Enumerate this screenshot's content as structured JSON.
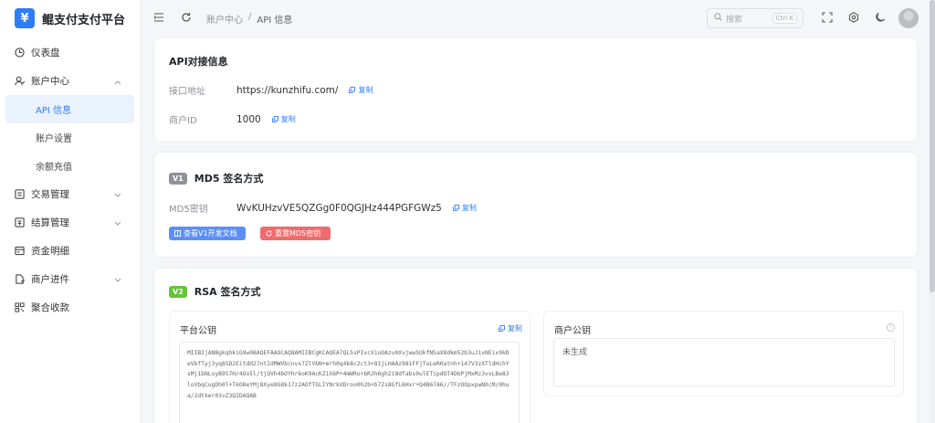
{
  "brand": {
    "title": "鲲支付支付平台",
    "logo_glyph": "¥"
  },
  "sidebar": {
    "items": [
      {
        "label": "仪表盘",
        "icon": "dashboard-icon"
      },
      {
        "label": "账户中心",
        "icon": "user-icon",
        "expanded": true,
        "children": [
          {
            "label": "API 信息",
            "active": true
          },
          {
            "label": "账户设置"
          },
          {
            "label": "余额充值"
          }
        ]
      },
      {
        "label": "交易管理",
        "icon": "list-icon"
      },
      {
        "label": "结算管理",
        "icon": "settle-icon"
      },
      {
        "label": "资金明细",
        "icon": "wallet-icon"
      },
      {
        "label": "商户进件",
        "icon": "doc-icon"
      },
      {
        "label": "聚合收款",
        "icon": "qrcode-icon"
      }
    ]
  },
  "header": {
    "breadcrumb": {
      "parent": "账户中心",
      "separator": "/",
      "current": "API 信息"
    },
    "search": {
      "placeholder": "搜索",
      "shortcut": "Ctrl K"
    }
  },
  "api_info": {
    "title": "API对接信息",
    "endpoint_label": "接口地址",
    "endpoint_value": "https://kunzhifu.com/",
    "merchant_label": "商户ID",
    "merchant_value": "1000",
    "copy_label": "复制"
  },
  "md5": {
    "tag": "V1",
    "title": "MD5 签名方式",
    "key_label": "MD5密钥",
    "key_value": "WvKUHzvVE5QZGg0F0QGJHz444PGFGWz5",
    "copy_label": "复制",
    "doc_button": "查看V1开发文档",
    "reset_button": "重置MD5密钥"
  },
  "rsa": {
    "tag": "V2",
    "title": "RSA 签名方式",
    "platform_key_label": "平台公钥",
    "copy_label": "复制",
    "platform_key_value": "MIIBIjANBgkqhkiG9w0BAQEFAAOCAQ8AMIIBCgKCAQEA7QL5sPIxcX1oOAzu0XvjwwSUkfN5aX8dkm52b3uJ1xNEix9kDeVbfTyj3yq8SD2Eitdd27ntIdMWVbcnvx7ZlVbN+mrh0q4k8c2ct3+81jLHAAz981FFjToLeR0atnh+147V3zXTldHchYsMj1bNLoyB957H/4Oo5l/tjQVh4bOYhr6oK9AcKZiX6P+4mWRo+bRJh6gh2i8dfabs0ulETipdOT4DbPjMxMz3vxLBe83loVbqCugDh0l+TkO8eYMj8Xye8G8k17z2AOfTGLIYNrkXDroo0h2b+b7Zs8GfL6Hxr+Q4B67A6//TFzOOpxpwNXcM/0hua/2dtker03vZ3QIDAQAB",
    "merchant_key_label": "商户公钥",
    "merchant_key_value": "未生成"
  }
}
